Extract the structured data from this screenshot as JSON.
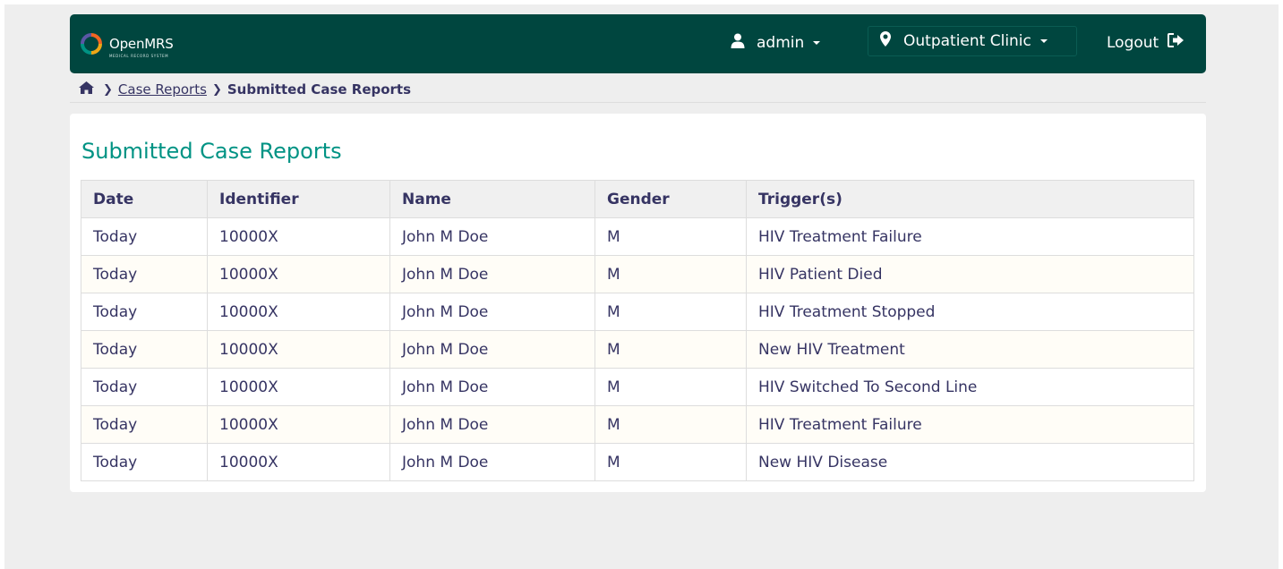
{
  "header": {
    "logo_text": "OpenMRS",
    "logo_subtext": "MEDICAL RECORD SYSTEM",
    "user_label": "admin",
    "location_label": "Outpatient Clinic",
    "logout_label": "Logout"
  },
  "breadcrumb": {
    "link_label": "Case Reports",
    "current_label": "Submitted Case Reports"
  },
  "main": {
    "title": "Submitted Case Reports",
    "table": {
      "headers": [
        "Date",
        "Identifier",
        "Name",
        "Gender",
        "Trigger(s)"
      ],
      "rows": [
        [
          "Today",
          "10000X",
          "John M Doe",
          "M",
          "HIV Treatment Failure"
        ],
        [
          "Today",
          "10000X",
          "John M Doe",
          "M",
          "HIV Patient Died"
        ],
        [
          "Today",
          "10000X",
          "John M Doe",
          "M",
          "HIV Treatment Stopped"
        ],
        [
          "Today",
          "10000X",
          "John M Doe",
          "M",
          "New HIV Treatment"
        ],
        [
          "Today",
          "10000X",
          "John M Doe",
          "M",
          "HIV Switched To Second Line"
        ],
        [
          "Today",
          "10000X",
          "John M Doe",
          "M",
          "HIV Treatment Failure"
        ],
        [
          "Today",
          "10000X",
          "John M Doe",
          "M",
          "New HIV Disease"
        ]
      ]
    }
  },
  "colors": {
    "header_bg": "#00463f",
    "title": "#009384",
    "text": "#363463",
    "logo_orange": "#f26522",
    "logo_blue": "#5b57a6",
    "logo_green": "#009384",
    "logo_yellow": "#eea616"
  },
  "icons": {
    "user": "user-icon",
    "location": "map-marker-icon",
    "logout": "sign-out-icon",
    "home": "home-icon",
    "separator": "chevron-right-icon"
  }
}
